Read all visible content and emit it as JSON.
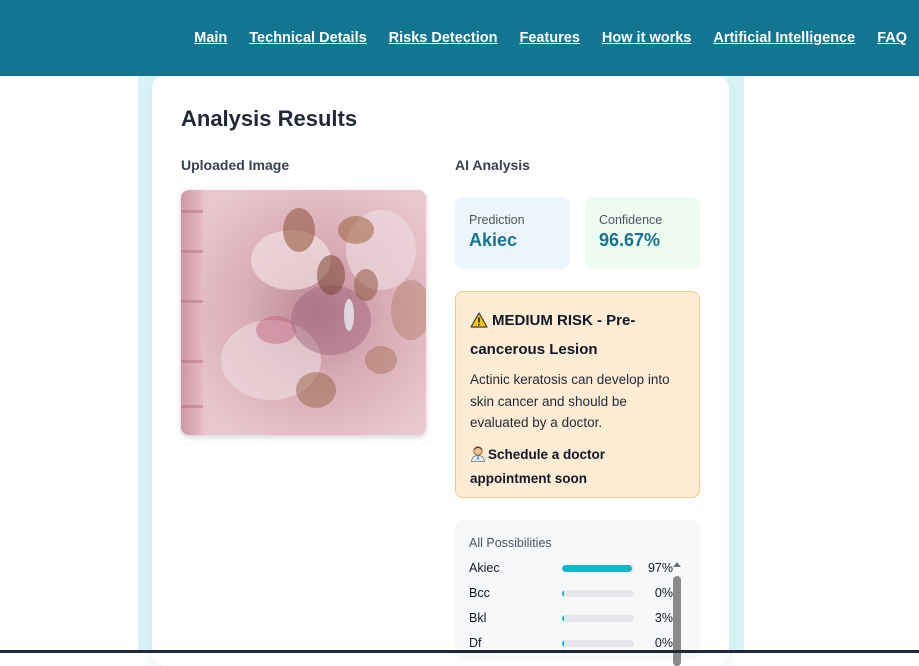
{
  "nav": {
    "links": [
      "Main",
      "Technical Details",
      "Risks Detection",
      "Features",
      "How it works",
      "Artificial Intelligence",
      "FAQ"
    ]
  },
  "card": {
    "title": "Analysis Results",
    "uploaded_label": "Uploaded Image",
    "ai_label": "AI Analysis"
  },
  "prediction": {
    "label": "Prediction",
    "value": "Akiec"
  },
  "confidence": {
    "label": "Confidence",
    "value": "96.67%"
  },
  "risk": {
    "title": "MEDIUM RISK - Pre-cancerous Lesion",
    "description": "Actinic keratosis can develop into skin cancer and should be evaluated by a doctor.",
    "action": "Schedule a doctor appointment soon"
  },
  "possibilities": {
    "title": "All Possibilities",
    "items": [
      {
        "name": "Akiec",
        "percent": "97%",
        "fraction": 0.97
      },
      {
        "name": "Bcc",
        "percent": "0%",
        "fraction": 0.0
      },
      {
        "name": "Bkl",
        "percent": "3%",
        "fraction": 0.03
      },
      {
        "name": "Df",
        "percent": "0%",
        "fraction": 0.0
      }
    ]
  },
  "colors": {
    "navbar": "#127591",
    "accent": "#127591",
    "bar_fill": "#13b5d1",
    "risk_bg": "#ffecd5",
    "prediction_bg": "#eef5fd",
    "confidence_bg": "#eefbf1"
  },
  "icons": [
    "warning-icon",
    "doctor-icon"
  ]
}
